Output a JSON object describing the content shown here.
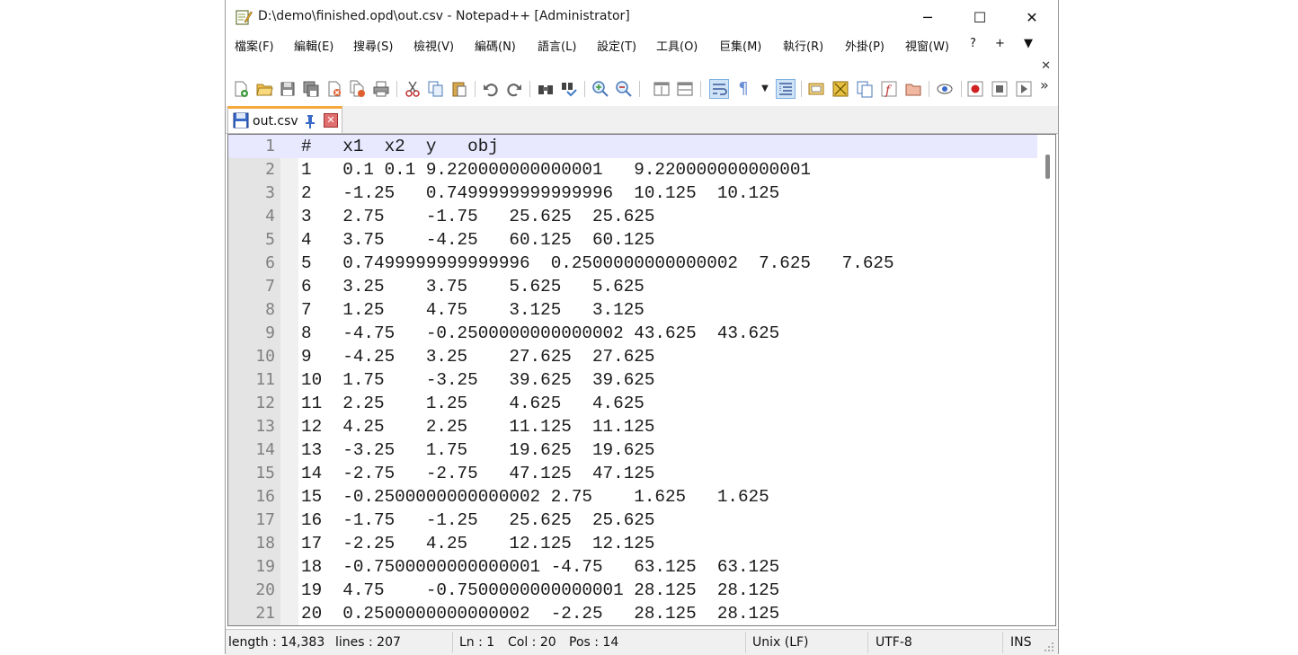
{
  "window": {
    "title": "D:\\demo\\finished.opd\\out.csv - Notepad++ [Administrator]",
    "minimize_glyph": "─",
    "maximize_glyph": "☐",
    "close_glyph": "✕"
  },
  "menu": [
    "檔案(F)",
    "編輯(E)",
    "搜尋(S)",
    "檢視(V)",
    "編碼(N)",
    "語言(L)",
    "設定(T)",
    "工具(O)",
    "巨集(M)",
    "執行(R)",
    "外掛(P)",
    "視窗(W)",
    "?",
    "+",
    "▼"
  ],
  "close_doc_glyph": "✕",
  "tab": {
    "label": "out.csv",
    "close_glyph": "✕"
  },
  "toolbar_overflow_glyph": "»",
  "editor": {
    "current_line": 1,
    "lines": [
      "#   x1  x2  y   obj",
      "1   0.1 0.1 9.220000000000001   9.220000000000001",
      "2   -1.25   0.7499999999999996  10.125  10.125",
      "3   2.75    -1.75   25.625  25.625",
      "4   3.75    -4.25   60.125  60.125",
      "5   0.7499999999999996  0.2500000000000002  7.625   7.625",
      "6   3.25    3.75    5.625   5.625",
      "7   1.25    4.75    3.125   3.125",
      "8   -4.75   -0.2500000000000002 43.625  43.625",
      "9   -4.25   3.25    27.625  27.625",
      "10  1.75    -3.25   39.625  39.625",
      "11  2.25    1.25    4.625   4.625",
      "12  4.25    2.25    11.125  11.125",
      "13  -3.25   1.75    19.625  19.625",
      "14  -2.75   -2.75   47.125  47.125",
      "15  -0.2500000000000002 2.75    1.625   1.625",
      "16  -1.75   -1.25   25.625  25.625",
      "17  -2.25   4.25    12.125  12.125",
      "18  -0.7500000000000001 -4.75   63.125  63.125",
      "19  4.75    -0.7500000000000001 28.125  28.125",
      "20  0.2500000000000002  -2.25   28.125  28.125"
    ]
  },
  "status": {
    "length": "length : 14,383",
    "lines": "lines : 207",
    "ln": "Ln : 1",
    "col": "Col : 20",
    "pos": "Pos : 14",
    "eol": "Unix (LF)",
    "encoding": "UTF-8",
    "mode": "INS"
  },
  "colors": {
    "tab_accent": "#f5a93c",
    "current_line": "#e8e8ff",
    "line_number": "#808080"
  }
}
